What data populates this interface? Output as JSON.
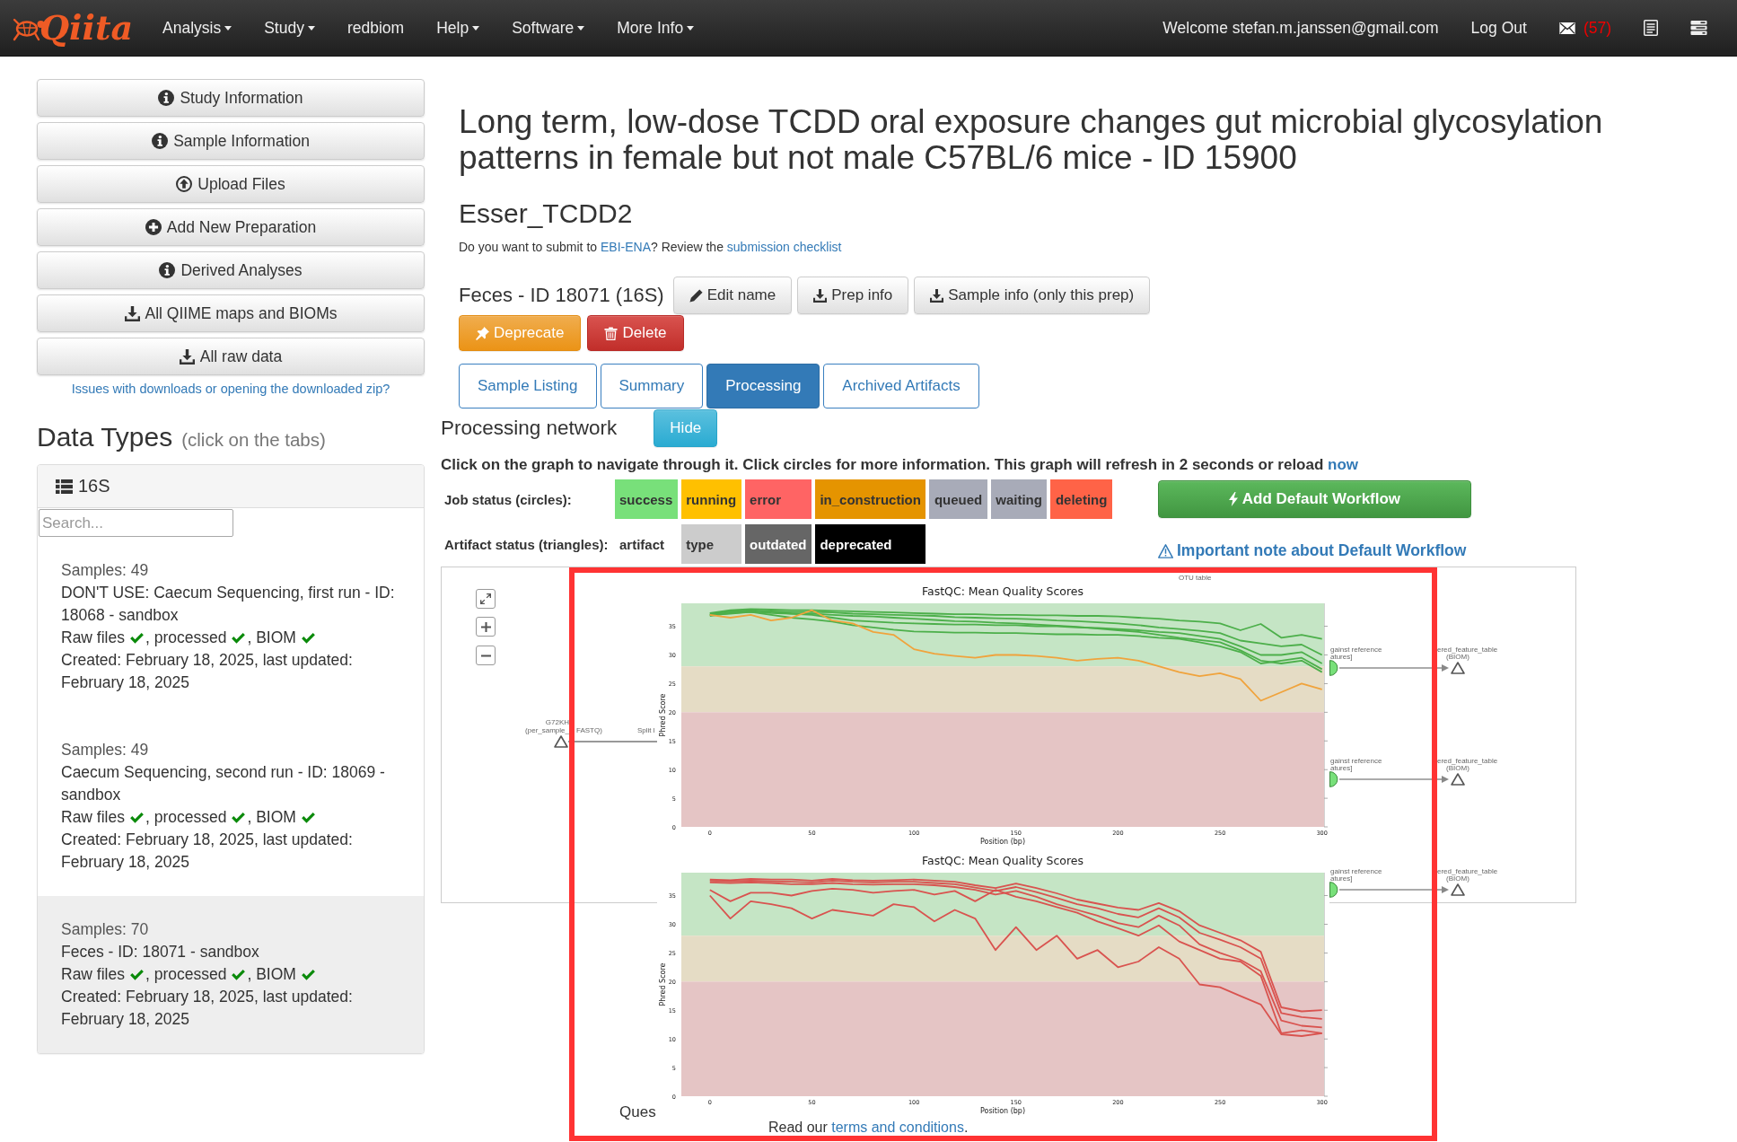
{
  "navbar": {
    "logo": "Qiita",
    "menus": [
      {
        "label": "Analysis",
        "dropdown": true
      },
      {
        "label": "Study",
        "dropdown": true
      },
      {
        "label": "redbiom",
        "dropdown": false
      },
      {
        "label": "Help",
        "dropdown": true
      },
      {
        "label": "Software",
        "dropdown": true
      },
      {
        "label": "More Info",
        "dropdown": true
      }
    ],
    "user": "Welcome stefan.m.janssen@gmail.com",
    "logout": "Log Out",
    "messages": "(57)"
  },
  "sidebar": {
    "buttons": [
      {
        "label": "Study Information",
        "kind": "info"
      },
      {
        "label": "Sample Information",
        "kind": "info"
      },
      {
        "label": "Upload Files",
        "kind": "upload"
      },
      {
        "label": "Add New Preparation",
        "kind": "add"
      },
      {
        "label": "Derived Analyses",
        "kind": "info"
      },
      {
        "label": "All QIIME maps and BIOMs",
        "kind": "download"
      },
      {
        "label": "All raw data",
        "kind": "download"
      }
    ],
    "help_link": "Issues with downloads or opening the downloaded zip?",
    "data_types": {
      "title": "Data Types",
      "hint": "(click on the tabs)",
      "panel": {
        "title": "16S",
        "search": {
          "placeholder": "Search..."
        },
        "preps": [
          {
            "samples": "Samples: 49",
            "name": "DON'T USE: Caecum Sequencing, first run - ID: 18068 - sandbox",
            "files": [
              {
                "label": "Raw files",
                "checked": true
              },
              {
                "label": ", processed",
                "checked": true
              },
              {
                "label": ", BIOM",
                "checked": true
              }
            ],
            "dates": "Created: February 18, 2025, last updated: February 18, 2025",
            "selected": false
          },
          {
            "samples": "Samples: 49",
            "name": "Caecum Sequencing, second run - ID: 18069 - sandbox",
            "files": [
              {
                "label": "Raw files",
                "checked": true
              },
              {
                "label": ", processed",
                "checked": true
              },
              {
                "label": ", BIOM",
                "checked": true
              }
            ],
            "dates": "Created: February 18, 2025, last updated: February 18, 2025",
            "selected": false
          },
          {
            "samples": "Samples: 70",
            "name": "Feces - ID: 18071 - sandbox",
            "files": [
              {
                "label": "Raw files",
                "checked": true
              },
              {
                "label": ", processed",
                "checked": true
              },
              {
                "label": ", BIOM",
                "checked": true
              }
            ],
            "dates": "Created: February 18, 2025, last updated: February 18, 2025",
            "selected": true
          }
        ]
      }
    }
  },
  "study": {
    "title": "Long term, low-dose TCDD oral exposure changes gut microbial glycosylation patterns in female but not male C57BL/6 mice - ID 15900",
    "alias": "Esser_TCDD2",
    "notice": [
      {
        "text": "Do you want to submit to ",
        "link": false
      },
      {
        "text": "EBI-ENA",
        "link": true
      },
      {
        "text": "? Review the ",
        "link": false
      },
      {
        "text": "submission checklist",
        "link": true
      }
    ]
  },
  "prep": {
    "title": "Feces - ID 18071 (16S)",
    "actions": [
      {
        "label": "Edit name",
        "kind": "edit"
      },
      {
        "label": "Prep info",
        "kind": "download"
      },
      {
        "label": "Sample info (only this prep)",
        "kind": "download"
      }
    ],
    "manage": [
      {
        "label": "Deprecate",
        "kind": "deprecate"
      },
      {
        "label": "Delete",
        "kind": "delete"
      }
    ],
    "tabs": [
      {
        "label": "Sample Listing",
        "selected": false
      },
      {
        "label": "Summary",
        "selected": false
      },
      {
        "label": "Processing",
        "selected": true
      },
      {
        "label": "Archived Artifacts",
        "selected": false
      }
    ]
  },
  "processing": {
    "title": "Processing network",
    "toggle": "Hide",
    "instructions": [
      {
        "text": "Click on the graph to navigate through it. Click circles for more information. This graph will refresh in 2 seconds or reload ",
        "link": false
      },
      {
        "text": "now",
        "link": true
      }
    ],
    "job_status": {
      "label": "Job status (circles):",
      "items": [
        {
          "label": "success",
          "color": "#78e07a"
        },
        {
          "label": "running",
          "color": "#ffc000"
        },
        {
          "label": "error",
          "color": "#ff6464"
        },
        {
          "label": "in_construction",
          "color": "#e59400"
        },
        {
          "label": "queued",
          "color": "#a8abb8"
        },
        {
          "label": "waiting",
          "color": "#a8abb8"
        },
        {
          "label": "deleting",
          "color": "#ff6347"
        }
      ]
    },
    "artifact_status": {
      "label": "Artifact status (triangles):",
      "items": [
        {
          "label": "artifact",
          "color": "#ffffff"
        },
        {
          "label": "type",
          "color": "#cccccc"
        },
        {
          "label": "outdated",
          "color": "#666666"
        },
        {
          "label": "deprecated",
          "color": "#000000"
        }
      ]
    },
    "workflow_button": "Add Default Workflow",
    "workflow_note": "Important note about Default Workflow",
    "network": {
      "source": {
        "name": "G72KH",
        "type_parts": [
          "(per_sample_",
          "FASTQ)"
        ]
      },
      "next_job": "Split l",
      "hidden_output": "OTU table",
      "outputs": [
        {
          "job_lines": [
            "gainst reference",
            "atures]"
          ],
          "color": "#78e07a",
          "artifact_lines": [
            "ered_feature_table",
            "(BIOM)"
          ]
        },
        {
          "job_lines": [
            "gainst reference",
            "atures]"
          ],
          "color": "#78e07a",
          "artifact_lines": [
            "ered_feature_table",
            "(BIOM)"
          ]
        },
        {
          "job_lines": [
            "gainst reference",
            "atures]"
          ],
          "color": "#78e07a",
          "artifact_lines": [
            "ered_feature_table",
            "(BIOM)"
          ]
        }
      ]
    },
    "quality_plots": [
      {
        "chart_data": {
          "type": "line",
          "title": "FastQC: Mean Quality Scores",
          "xlabel": "Position (bp)",
          "ylabel": "Phred Score",
          "x": [
            0,
            10,
            20,
            30,
            40,
            50,
            60,
            70,
            80,
            90,
            100,
            110,
            120,
            130,
            140,
            150,
            160,
            170,
            180,
            190,
            200,
            210,
            220,
            230,
            240,
            250,
            260,
            270,
            280,
            290,
            300
          ],
          "xlim": [
            -14,
            301
          ],
          "ylim": [
            0,
            39
          ],
          "xticks": [
            0,
            50,
            100,
            150,
            200,
            250,
            300
          ],
          "yticks": [
            0,
            5,
            10,
            15,
            20,
            25,
            30,
            35
          ],
          "bands": [
            {
              "axis": "y",
              "from": 28,
              "to": 39,
              "color": "#c5e5c5"
            },
            {
              "axis": "y",
              "from": 20,
              "to": 28,
              "color": "#e5dcc5"
            },
            {
              "axis": "y",
              "from": 0,
              "to": 20,
              "color": "#e5c5c5"
            }
          ],
          "series": [
            {
              "color": "#4caf4a",
              "values": [
                37.3,
                37.8,
                38,
                37.9,
                37.8,
                37.8,
                37.7,
                37.6,
                37.5,
                37.4,
                37.3,
                37.2,
                37.1,
                37.1,
                37,
                37,
                36.9,
                36.9,
                36.8,
                36.8,
                36.7,
                36.5,
                36.3,
                36,
                35.8,
                35.5,
                34.3,
                35.4,
                33,
                33.5,
                32.8
              ]
            },
            {
              "color": "#4caf4a",
              "values": [
                37,
                37.6,
                37.8,
                37.6,
                37.5,
                37.5,
                37.4,
                37.2,
                37.1,
                37,
                36.9,
                36.8,
                36.6,
                36.5,
                36.4,
                36.3,
                36.2,
                36,
                35.9,
                35.7,
                35.5,
                35.2,
                34.8,
                34.5,
                34.2,
                33.8,
                32.5,
                32,
                31.5,
                31.8,
                30
              ]
            },
            {
              "color": "#4caf4a",
              "values": [
                36.8,
                37.3,
                37.5,
                37.3,
                37.2,
                37.2,
                37,
                36.8,
                36.7,
                36.5,
                36.3,
                36.1,
                35.9,
                35.8,
                35.6,
                35.5,
                35.3,
                35.1,
                34.9,
                34.6,
                34.3,
                34,
                33.5,
                33,
                32.6,
                32.2,
                30.8,
                29,
                28.5,
                29,
                27
              ]
            },
            {
              "color": "#4caf4a",
              "values": [
                37.2,
                37.5,
                37.7,
                37.5,
                37.2,
                37,
                36.5,
                36,
                35.8,
                35.6,
                35.5,
                35.4,
                35.3,
                35.3,
                35.2,
                35.2,
                35,
                35,
                34.8,
                34.7,
                34.5,
                34.3,
                34,
                33.8,
                33.3,
                32.8,
                31.5,
                30,
                30,
                30.5,
                28.5
              ]
            },
            {
              "color": "#4caf4a",
              "values": [
                37,
                37.2,
                37.5,
                37,
                36.5,
                36.2,
                35.8,
                35.2,
                34.8,
                34.4,
                34.1,
                34,
                33.9,
                33.9,
                33.8,
                33.8,
                33.7,
                33.6,
                33.6,
                33.5,
                33.5,
                33.3,
                33,
                32.8,
                32.2,
                31.5,
                30.5,
                28.5,
                29,
                29.5,
                27.5
              ]
            },
            {
              "color": "#f0a33c",
              "values": [
                37,
                36.5,
                37,
                36,
                36.5,
                37.8,
                36,
                35.5,
                34,
                33.5,
                31,
                30.2,
                29.8,
                29.5,
                30,
                30,
                29.8,
                29.5,
                29,
                29.3,
                29.5,
                29,
                28,
                27,
                26.3,
                26.8,
                25.8,
                22,
                23.5,
                25,
                24
              ]
            }
          ]
        }
      },
      {
        "chart_data": {
          "type": "line",
          "title": "FastQC: Mean Quality Scores",
          "xlabel": "Position (bp)",
          "ylabel": "Phred Score",
          "x": [
            0,
            10,
            20,
            30,
            40,
            50,
            60,
            70,
            80,
            90,
            100,
            110,
            120,
            130,
            140,
            150,
            160,
            170,
            180,
            190,
            200,
            210,
            220,
            230,
            240,
            250,
            260,
            270,
            280,
            290,
            300
          ],
          "xlim": [
            -14,
            301
          ],
          "ylim": [
            0,
            39
          ],
          "xticks": [
            0,
            50,
            100,
            150,
            200,
            250,
            300
          ],
          "yticks": [
            0,
            5,
            10,
            15,
            20,
            25,
            30,
            35
          ],
          "bands": [
            {
              "axis": "y",
              "from": 28,
              "to": 39,
              "color": "#c5e5c5"
            },
            {
              "axis": "y",
              "from": 20,
              "to": 28,
              "color": "#e5dcc5"
            },
            {
              "axis": "y",
              "from": 0,
              "to": 20,
              "color": "#e5c5c5"
            }
          ],
          "series": [
            {
              "color": "#d9534f",
              "values": [
                37.8,
                37.7,
                37.9,
                37.8,
                37.8,
                37.6,
                37.9,
                37.7,
                37.6,
                37.7,
                37.8,
                37.6,
                37.4,
                36.8,
                36.3,
                37.1,
                36.3,
                35.4,
                34.3,
                33.6,
                32.9,
                32.5,
                33.7,
                32.3,
                29.8,
                28.5,
                27.2,
                25.2,
                15.5,
                14.8,
                15
              ]
            },
            {
              "color": "#d9534f",
              "values": [
                37.6,
                37.5,
                37.6,
                37.5,
                37.4,
                37.3,
                37.6,
                37.4,
                37.3,
                37.4,
                37.4,
                37.2,
                37,
                36.4,
                35.8,
                36.5,
                35.6,
                34.6,
                33.5,
                32.8,
                31.8,
                31.2,
                32.8,
                31.2,
                28.5,
                27.3,
                26,
                24,
                14.5,
                13.8,
                13.5
              ]
            },
            {
              "color": "#d9534f",
              "values": [
                37.3,
                37.2,
                37.3,
                37.2,
                37,
                37,
                37.2,
                37,
                36.9,
                37,
                37,
                36.8,
                36.5,
                36,
                35.2,
                35.8,
                34.8,
                33.5,
                32.5,
                31.5,
                30.2,
                29.5,
                31.5,
                29.8,
                26.5,
                25,
                23.8,
                21.8,
                13.2,
                12.3,
                12
              ]
            },
            {
              "color": "#d9534f",
              "values": [
                36,
                34,
                35.5,
                35.5,
                35,
                35.8,
                36.2,
                36,
                35.5,
                35.8,
                36,
                35.2,
                35.8,
                34,
                36,
                34.8,
                34,
                33,
                32,
                30.5,
                29.3,
                28,
                29.8,
                27,
                25.5,
                24,
                23.5,
                21,
                11,
                11.5,
                11
              ]
            },
            {
              "color": "#d9534f",
              "values": [
                35,
                31,
                34,
                33.5,
                32.8,
                31,
                32.5,
                32,
                31.5,
                33.5,
                33,
                30.5,
                32.5,
                31,
                25.5,
                29.5,
                25.5,
                28,
                24,
                25.5,
                22.5,
                23.5,
                26,
                24,
                19.5,
                19,
                17.5,
                16,
                10.8,
                10.5,
                11
              ]
            }
          ]
        }
      }
    ]
  },
  "footer": {
    "question": "Ques",
    "terms": [
      {
        "text": "Read our ",
        "link": false
      },
      {
        "text": "terms and conditions",
        "link": true
      },
      {
        "text": ".",
        "link": false
      }
    ]
  }
}
